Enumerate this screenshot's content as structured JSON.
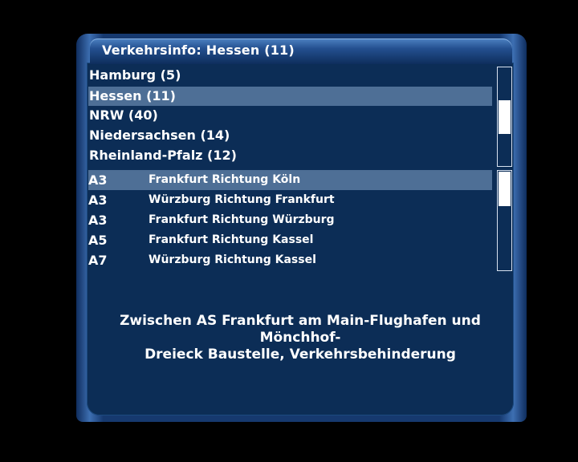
{
  "window": {
    "title": "Verkehrsinfo: Hessen (11)"
  },
  "regions": [
    {
      "label": "Hamburg (5)",
      "selected": false
    },
    {
      "label": "Hessen (11)",
      "selected": true
    },
    {
      "label": "NRW (40)",
      "selected": false
    },
    {
      "label": "Niedersachsen (14)",
      "selected": false
    },
    {
      "label": "Rheinland-Pfalz (12)",
      "selected": false
    }
  ],
  "reports": [
    {
      "road": "A3",
      "direction": "Frankfurt Richtung Köln",
      "selected": true
    },
    {
      "road": "A3",
      "direction": "Würzburg Richtung Frankfurt",
      "selected": false
    },
    {
      "road": "A3",
      "direction": "Frankfurt Richtung Würzburg",
      "selected": false
    },
    {
      "road": "A5",
      "direction": "Frankfurt Richtung Kassel",
      "selected": false
    },
    {
      "road": "A7",
      "direction": "Würzburg Richtung Kassel",
      "selected": false
    }
  ],
  "detail": {
    "line1": "Zwischen AS Frankfurt am Main-Flughafen und Mönchhof-",
    "line2": "Dreieck Baustelle, Verkehrsbehinderung"
  },
  "colors": {
    "panel": "#0c2d56",
    "selection": "#4e6f96",
    "frame": "#3d6fb2"
  }
}
